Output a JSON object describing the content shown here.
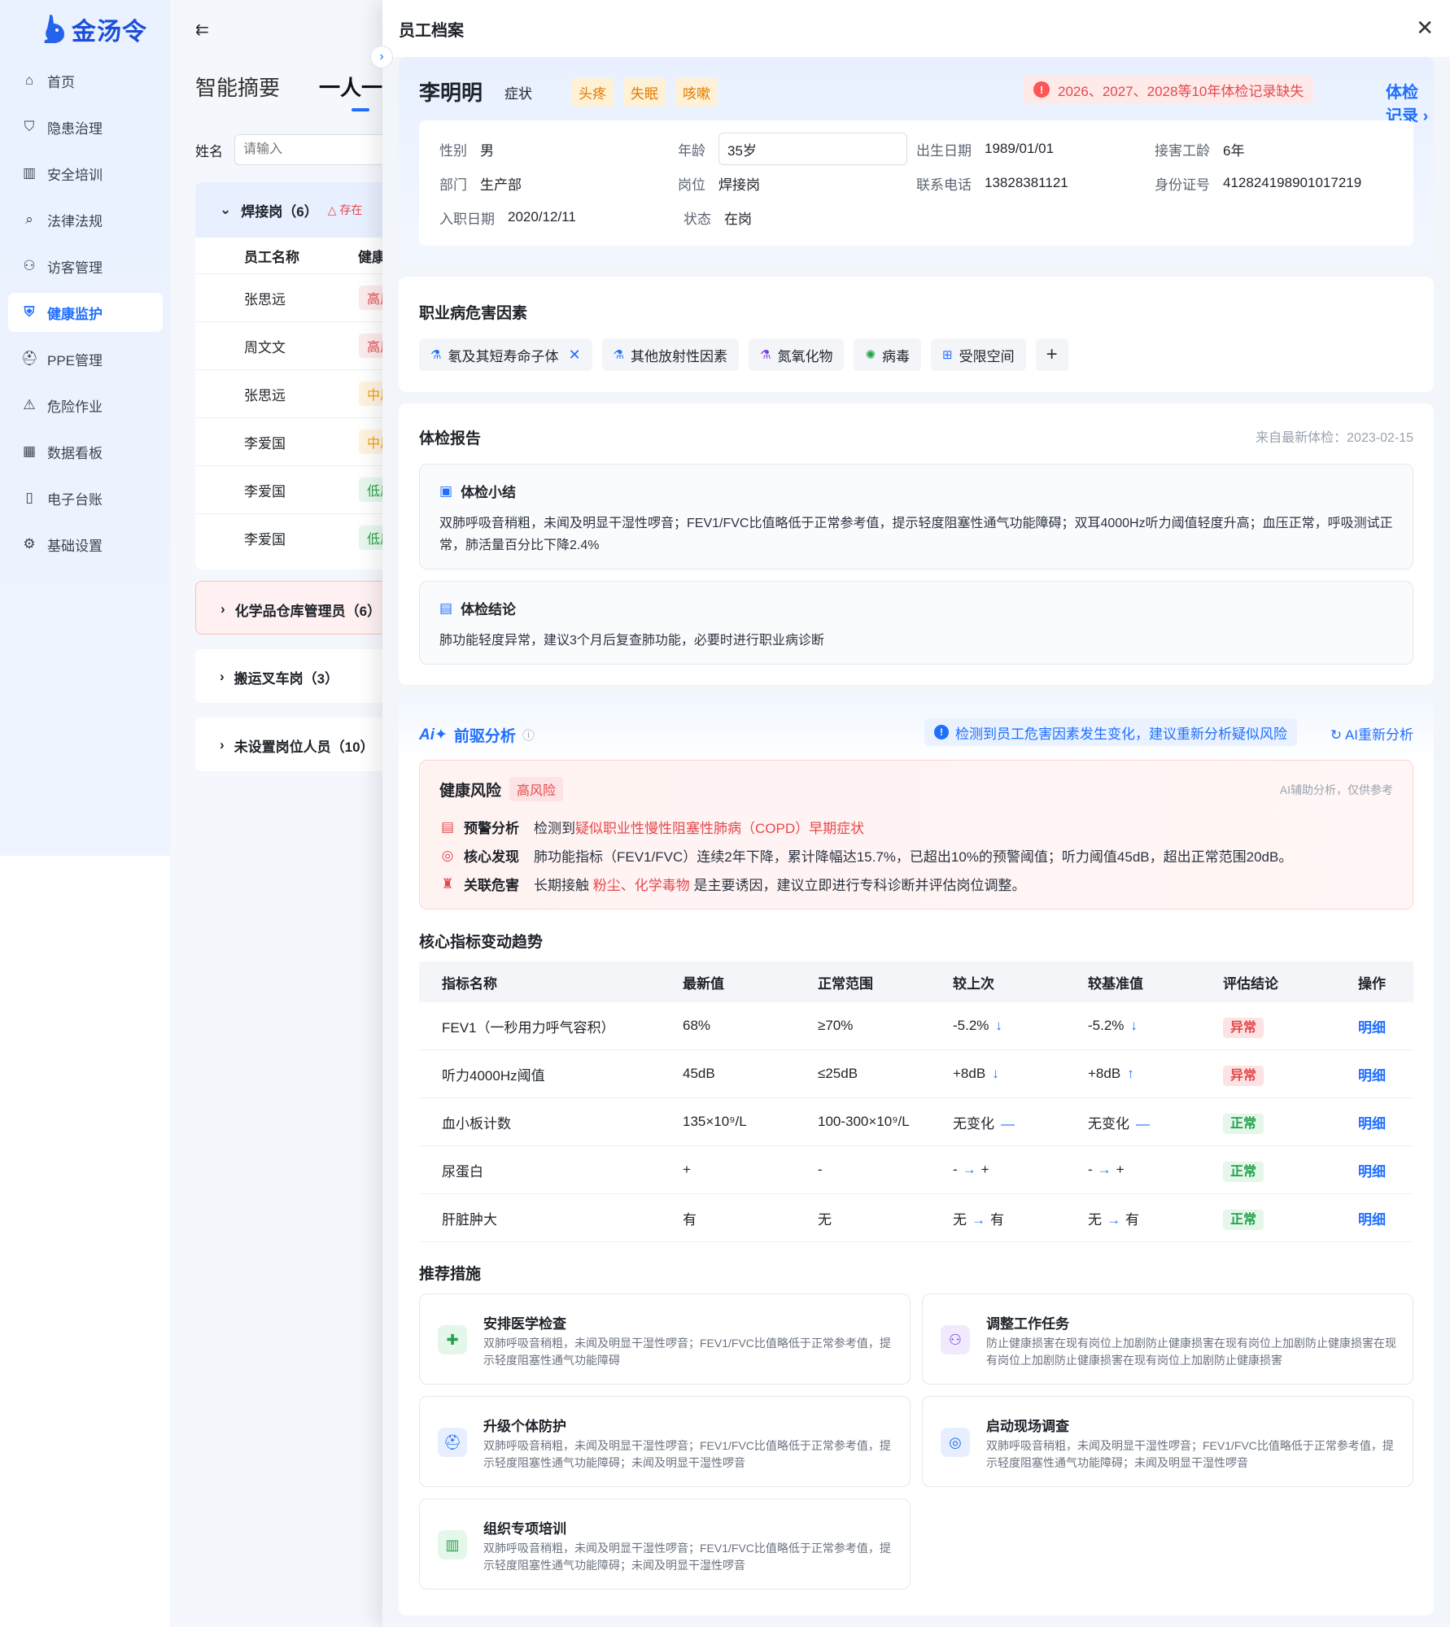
{
  "app": {
    "logo_text": "金汤令"
  },
  "sidebar": {
    "items": [
      {
        "label": "首页",
        "icon": "home-icon"
      },
      {
        "label": "隐患治理",
        "icon": "shield-icon"
      },
      {
        "label": "安全培训",
        "icon": "book-icon"
      },
      {
        "label": "法律法规",
        "icon": "document-search-icon"
      },
      {
        "label": "访客管理",
        "icon": "visitor-icon"
      },
      {
        "label": "健康监护",
        "icon": "health-shield-icon",
        "active": true
      },
      {
        "label": "PPE管理",
        "icon": "helmet-icon"
      },
      {
        "label": "危险作业",
        "icon": "warning-icon"
      },
      {
        "label": "数据看板",
        "icon": "dashboard-icon"
      },
      {
        "label": "电子台账",
        "icon": "ledger-icon"
      },
      {
        "label": "基础设置",
        "icon": "gear-icon"
      }
    ]
  },
  "background_page": {
    "tabs": [
      "智能摘要",
      "一人一档"
    ],
    "filter_label": "姓名",
    "filter_placeholder": "请输入",
    "groups": [
      {
        "title": "焊接岗（6）",
        "warning": "存在",
        "columns": [
          "员工名称",
          "健康"
        ],
        "rows": [
          {
            "name": "张思远",
            "risk": "高风",
            "level": "high"
          },
          {
            "name": "周文文",
            "risk": "高风",
            "level": "high"
          },
          {
            "name": "张思远",
            "risk": "中风",
            "level": "mid"
          },
          {
            "name": "李爱国",
            "risk": "中风",
            "level": "mid"
          },
          {
            "name": "李爱国",
            "risk": "低风",
            "level": "low"
          },
          {
            "name": "李爱国",
            "risk": "低风",
            "level": "low"
          }
        ]
      },
      {
        "title": "化学品仓库管理员（6）"
      },
      {
        "title": "搬运叉车岗（3）"
      },
      {
        "title": "未设置岗位人员（10）"
      }
    ]
  },
  "drawer": {
    "title": "员工档案",
    "profile": {
      "name": "李明明",
      "symptom_label": "症状",
      "symptoms": [
        "头疼",
        "失眠",
        "咳嗽"
      ],
      "missing_alert": "2026、2027、2028等10年体检记录缺失",
      "exam_link": "体检记录",
      "fields": [
        [
          {
            "k": "性别",
            "v": "男"
          },
          {
            "k": "年龄",
            "v": "35岁",
            "input": true
          },
          {
            "k": "出生日期",
            "v": "1989/01/01"
          },
          {
            "k": "接害工龄",
            "v": "6年"
          }
        ],
        [
          {
            "k": "部门",
            "v": "生产部"
          },
          {
            "k": "岗位",
            "v": "焊接岗"
          },
          {
            "k": "联系电话",
            "v": "13828381121"
          },
          {
            "k": "身份证号",
            "v": "412824198901017219"
          }
        ],
        [
          {
            "k": "入职日期",
            "v": "2020/12/11"
          },
          {
            "k": "状态",
            "v": "在岗"
          }
        ]
      ]
    },
    "hazards": {
      "title": "职业病危害因素",
      "items": [
        {
          "label": "氡及其短寿命子体",
          "removable": true
        },
        {
          "label": "其他放射性因素"
        },
        {
          "label": "氮氧化物"
        },
        {
          "label": "病毒"
        },
        {
          "label": "受限空间"
        }
      ],
      "add": "+"
    },
    "report": {
      "title": "体检报告",
      "source": "来自最新体检：2023-02-15",
      "summary_title": "体检小结",
      "summary": "双肺呼吸音稍粗，未闻及明显干湿性啰音；FEV1/FVC比值略低于正常参考值，提示轻度阻塞性通气功能障碍；双耳4000Hz听力阈值轻度升高；血压正常，呼吸测试正常，肺活量百分比下降2.4%",
      "conclusion_title": "体检结论",
      "conclusion": "肺功能轻度异常，建议3个月后复查肺功能，必要时进行职业病诊断"
    },
    "ai": {
      "title": "前驱分析",
      "notice": "检测到员工危害因素发生变化，建议重新分析疑似风险",
      "reanalyze": "AI重新分析",
      "risk_title": "健康风险",
      "risk_level": "高风险",
      "ai_note": "AI辅助分析，仅供参考",
      "lines": [
        {
          "k": "预警分析",
          "pre": "检测到",
          "hl": "疑似职业性慢性阻塞性肺病（COPD）早期症状",
          "post": ""
        },
        {
          "k": "核心发现",
          "pre": "肺功能指标（FEV1/FVC）连续2年下降，累计降幅达15.7%，已超出10%的预警阈值；听力阈值45dB，超出正常范围20dB。",
          "hl": "",
          "post": ""
        },
        {
          "k": "关联危害",
          "pre": "长期接触 ",
          "hl": "粉尘、化学毒物",
          "post": " 是主要诱因，建议立即进行专科诊断并评估岗位调整。"
        }
      ],
      "trend_title": "核心指标变动趋势",
      "table": {
        "headers": [
          "指标名称",
          "最新值",
          "正常范围",
          "较上次",
          "较基准值",
          "评估结论",
          "操作"
        ],
        "rows": [
          {
            "name": "FEV1（一秒用力呼气容积）",
            "latest": "68%",
            "range": "≥70%",
            "vs_last": "-5.2%",
            "vs_last_dir": "down",
            "vs_base": "-5.2%",
            "vs_base_dir": "down",
            "result": "异常",
            "ok": false,
            "op": "明细"
          },
          {
            "name": "听力4000Hz阈值",
            "latest": "45dB",
            "range": "≤25dB",
            "vs_last": "+8dB",
            "vs_last_dir": "down",
            "vs_base": "+8dB",
            "vs_base_dir": "up",
            "result": "异常",
            "ok": false,
            "op": "明细"
          },
          {
            "name": "血小板计数",
            "latest": "135×10⁹/L",
            "range": "100-300×10⁹/L",
            "vs_last": "无变化",
            "vs_last_dir": "flat",
            "vs_base": "无变化",
            "vs_base_dir": "flat",
            "result": "正常",
            "ok": true,
            "op": "明细"
          },
          {
            "name": "尿蛋白",
            "latest": "+",
            "range": "-",
            "vs_last_from": "-",
            "vs_last_to": "+",
            "vs_base_from": "-",
            "vs_base_to": "+",
            "result": "正常",
            "ok": true,
            "op": "明细"
          },
          {
            "name": "肝脏肿大",
            "latest": "有",
            "range": "无",
            "vs_last_from": "无",
            "vs_last_to": "有",
            "vs_base_from": "无",
            "vs_base_to": "有",
            "result": "正常",
            "ok": true,
            "op": "明细"
          }
        ]
      },
      "rec_title": "推荐措施",
      "recs": [
        {
          "title": "安排医学检查",
          "desc": "双肺呼吸音稍粗，未闻及明显干湿性啰音；FEV1/FVC比值略低于正常参考值，提示轻度阻塞性通气功能障碍",
          "icon": "medical-check-icon"
        },
        {
          "title": "调整工作任务",
          "desc": "防止健康损害在现有岗位上加剧防止健康损害在现有岗位上加剧防止健康损害在现有岗位上加剧防止健康损害在现有岗位上加剧防止健康损害",
          "icon": "people-adjust-icon"
        },
        {
          "title": "升级个体防护",
          "desc": "双肺呼吸音稍粗，未闻及明显干湿性啰音；FEV1/FVC比值略低于正常参考值，提示轻度阻塞性通气功能障碍；未闻及明显干湿性啰音",
          "icon": "helmet-icon"
        },
        {
          "title": "启动现场调查",
          "desc": "双肺呼吸音稍粗，未闻及明显干湿性啰音；FEV1/FVC比值略低于正常参考值，提示轻度阻塞性通气功能障碍；未闻及明显干湿性啰音",
          "icon": "survey-icon"
        },
        {
          "title": "组织专项培训",
          "desc": "双肺呼吸音稍粗，未闻及明显干湿性啰音；FEV1/FVC比值略低于正常参考值，提示轻度阻塞性通气功能障碍；未闻及明显干湿性啰音",
          "icon": "training-book-icon"
        }
      ]
    }
  }
}
